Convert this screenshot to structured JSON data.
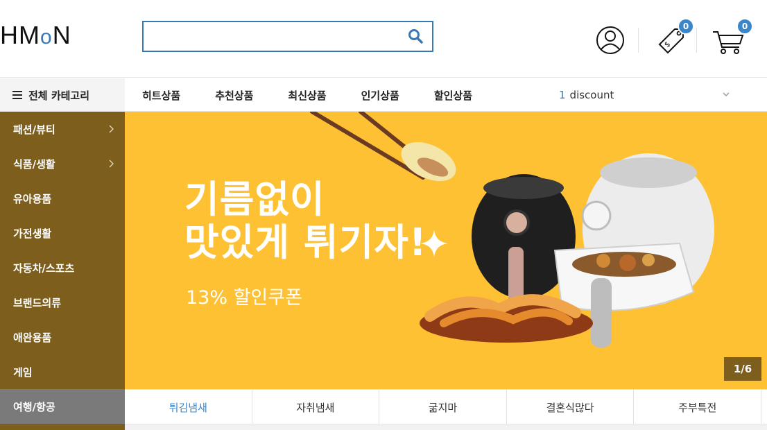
{
  "header": {
    "logo_prefix": "HM",
    "logo_o": "o",
    "logo_suffix": "N",
    "search": {
      "value": "",
      "placeholder": ""
    },
    "wishlist_count": "0",
    "cart_count": "0"
  },
  "nav": {
    "all_categories": "전체 카테고리",
    "menu": [
      "히트상품",
      "추천상품",
      "최신상품",
      "인기상품",
      "할인상품"
    ],
    "ticker": {
      "index": "1",
      "text": "discount"
    }
  },
  "sidebar": {
    "items": [
      {
        "label": "패션/뷰티",
        "has_sub": true
      },
      {
        "label": "식품/생활",
        "has_sub": true
      },
      {
        "label": "유아용품",
        "has_sub": false
      },
      {
        "label": "가전생활",
        "has_sub": false
      },
      {
        "label": "자동차/스포츠",
        "has_sub": false
      },
      {
        "label": "브랜드의류",
        "has_sub": false
      },
      {
        "label": "애완용품",
        "has_sub": false
      },
      {
        "label": "게임",
        "has_sub": false
      },
      {
        "label": "여행/항공",
        "has_sub": false,
        "active": true
      }
    ]
  },
  "banner": {
    "headline_line1": "기름없이",
    "headline_line2": "맛있게 튀기자!",
    "subtext": "13% 할인쿠폰",
    "page_indicator": "1/6",
    "background": "#fdc133"
  },
  "tabs": [
    "튀김냄새",
    "자취냄새",
    "굶지마",
    "결혼식많다",
    "주부특전"
  ],
  "colors": {
    "accent": "#3a78b5",
    "sidebar": "#7d5e1d",
    "badge": "#3a86c8"
  }
}
